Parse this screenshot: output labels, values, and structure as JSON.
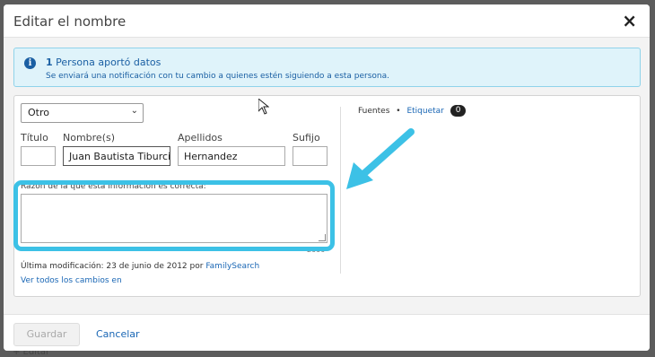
{
  "background": {
    "peek_text": "+ Editar"
  },
  "dialog": {
    "title": "Editar el nombre",
    "close_icon": "×"
  },
  "info": {
    "icon": "i",
    "count": "1",
    "headline": "Persona aportó datos",
    "message": "Se enviará una notificación con tu cambio a quienes estén siguiendo a esta persona."
  },
  "form": {
    "name_type": "Otro",
    "labels": {
      "title": "Título",
      "given": "Nombre(s)",
      "surname": "Apellidos",
      "suffix": "Sufijo"
    },
    "values": {
      "title": "",
      "given": "Juan Bautista Tiburcio",
      "surname": "Hernandez",
      "suffix": ""
    },
    "reason_label": "Razón de la que esta información es correcta:",
    "reason_value": "",
    "char_counter": "2000",
    "last_modified_prefix": "Última modificación: 23 de junio de 2012 por",
    "last_modified_by": "FamilySearch",
    "see_all_changes": "Ver todos los cambios en"
  },
  "sources": {
    "label": "Fuentes",
    "separator": "•",
    "tag_link": "Etiquetar",
    "count": "0"
  },
  "footer": {
    "save_label": "Guardar",
    "cancel_label": "Cancelar"
  },
  "colors": {
    "highlight": "#3cc1e6",
    "link": "#1a67b5",
    "info_bg": "#dff3fa"
  }
}
